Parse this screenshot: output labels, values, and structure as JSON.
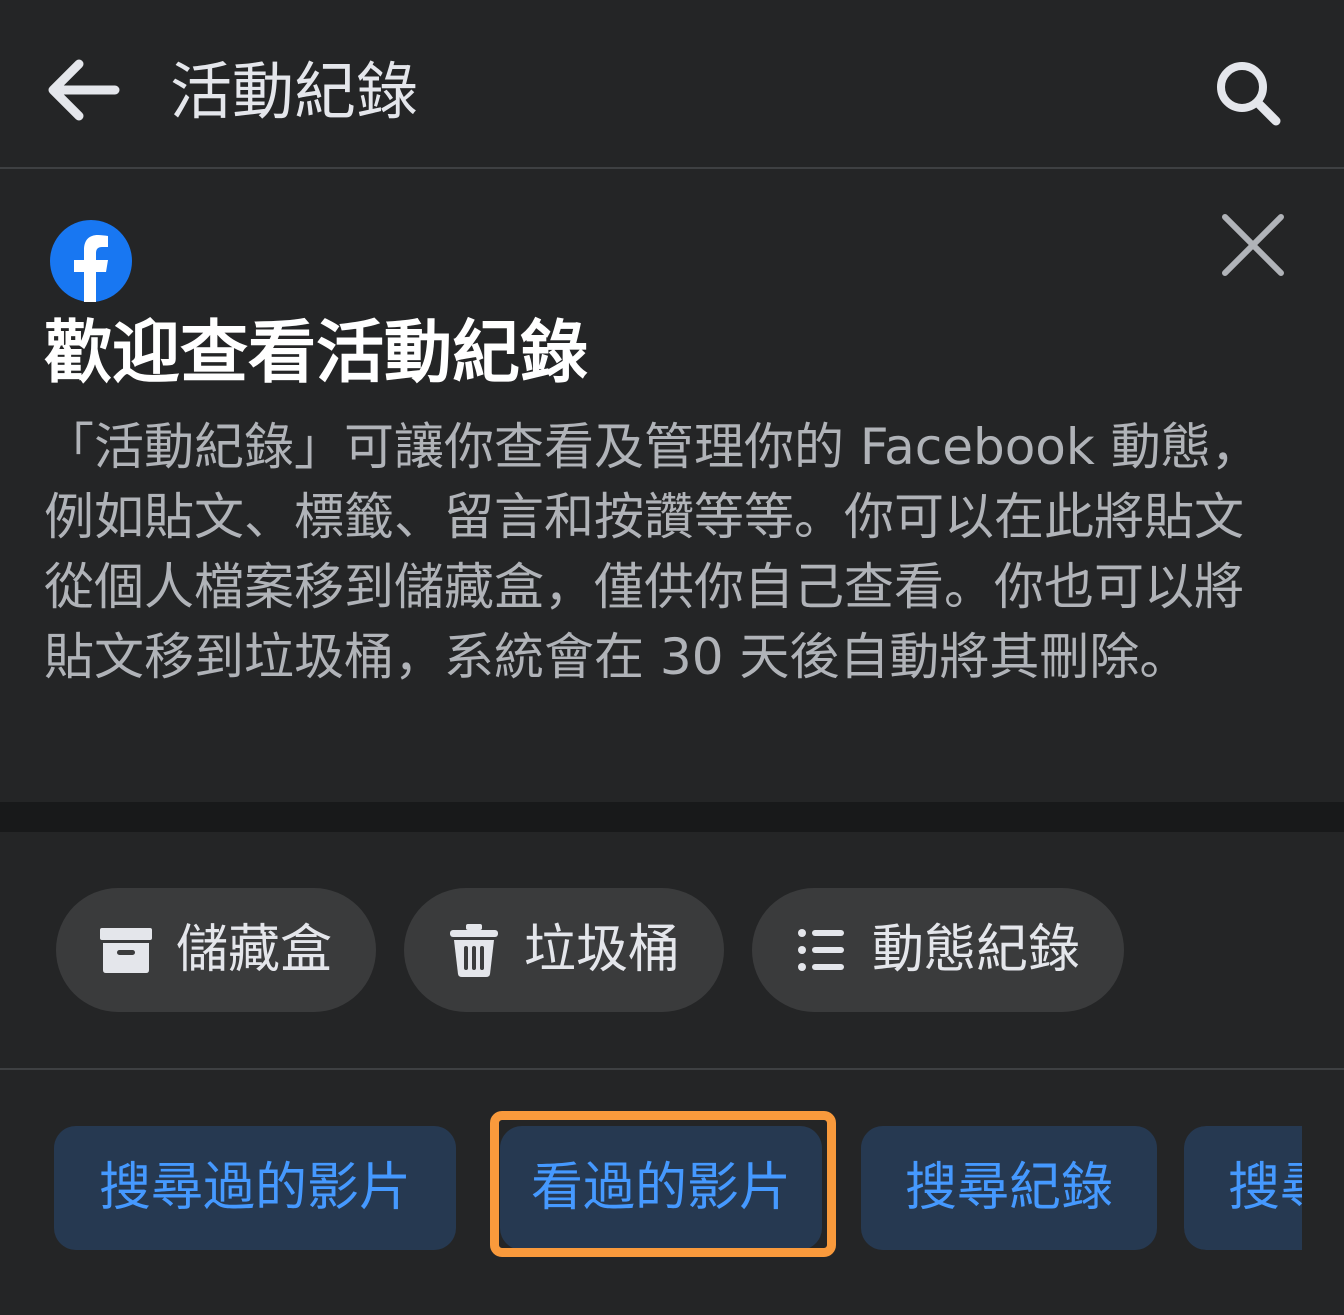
{
  "header": {
    "title": "活動紀錄",
    "back_icon": "back-arrow-icon",
    "search_icon": "search-icon"
  },
  "intro": {
    "logo": "facebook-logo-icon",
    "title": "歡迎查看活動紀錄",
    "body": "「活動紀錄」可讓你查看及管理你的 Facebook 動態，例如貼文、標籤、留言和按讚等等。你可以在此將貼文從個人檔案移到儲藏盒，僅供你自己查看。你也可以將貼文移到垃圾桶，系統會在 30 天後自動將其刪除。",
    "close_icon": "close-icon"
  },
  "actions": [
    {
      "label": "儲藏盒",
      "icon": "archive-icon"
    },
    {
      "label": "垃圾桶",
      "icon": "trash-icon"
    },
    {
      "label": "動態紀錄",
      "icon": "list-icon"
    }
  ],
  "filters": [
    {
      "label": "搜尋過的影片"
    },
    {
      "label": "看過的影片",
      "highlighted": true
    },
    {
      "label": "搜尋紀錄"
    },
    {
      "label": "搜尋"
    }
  ],
  "colors": {
    "background": "#242526",
    "chip_bg": "#263951",
    "chip_text": "#4599ff",
    "highlight": "#f99a3c",
    "facebook_blue": "#1877f2"
  }
}
